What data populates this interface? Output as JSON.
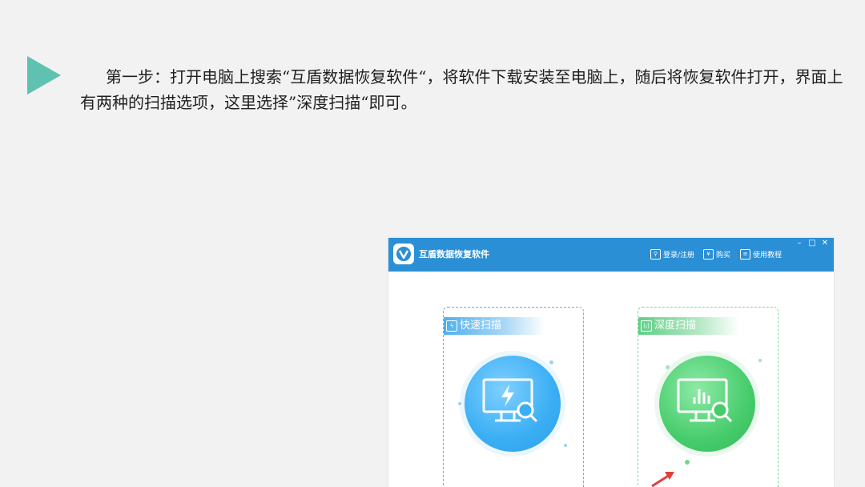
{
  "slide": {
    "instruction_text": "第一步：打开电脑上搜索“互盾数据恢复软件“，将软件下载安装至电脑上，随后将恢复软件打开，界面上有两种的扫描选项，这里选择”深度扫描“即可。",
    "accent_color": "#5fc1b0"
  },
  "app": {
    "title": "互盾数据恢复软件",
    "titlebar_color": "#2b8fd6",
    "actions": [
      {
        "label": "登录/注册",
        "icon": "login-icon"
      },
      {
        "label": "购买",
        "icon": "yen-icon"
      },
      {
        "label": "使用教程",
        "icon": "book-icon"
      }
    ],
    "window_controls": [
      "minimize-icon",
      "maximize-icon",
      "close-icon"
    ],
    "scan_options": [
      {
        "label": "快速扫描",
        "icon": "lightning-monitor-icon",
        "color": "#3aaef4"
      },
      {
        "label": "深度扫描",
        "icon": "chart-monitor-icon",
        "color": "#47cc6c"
      }
    ]
  }
}
